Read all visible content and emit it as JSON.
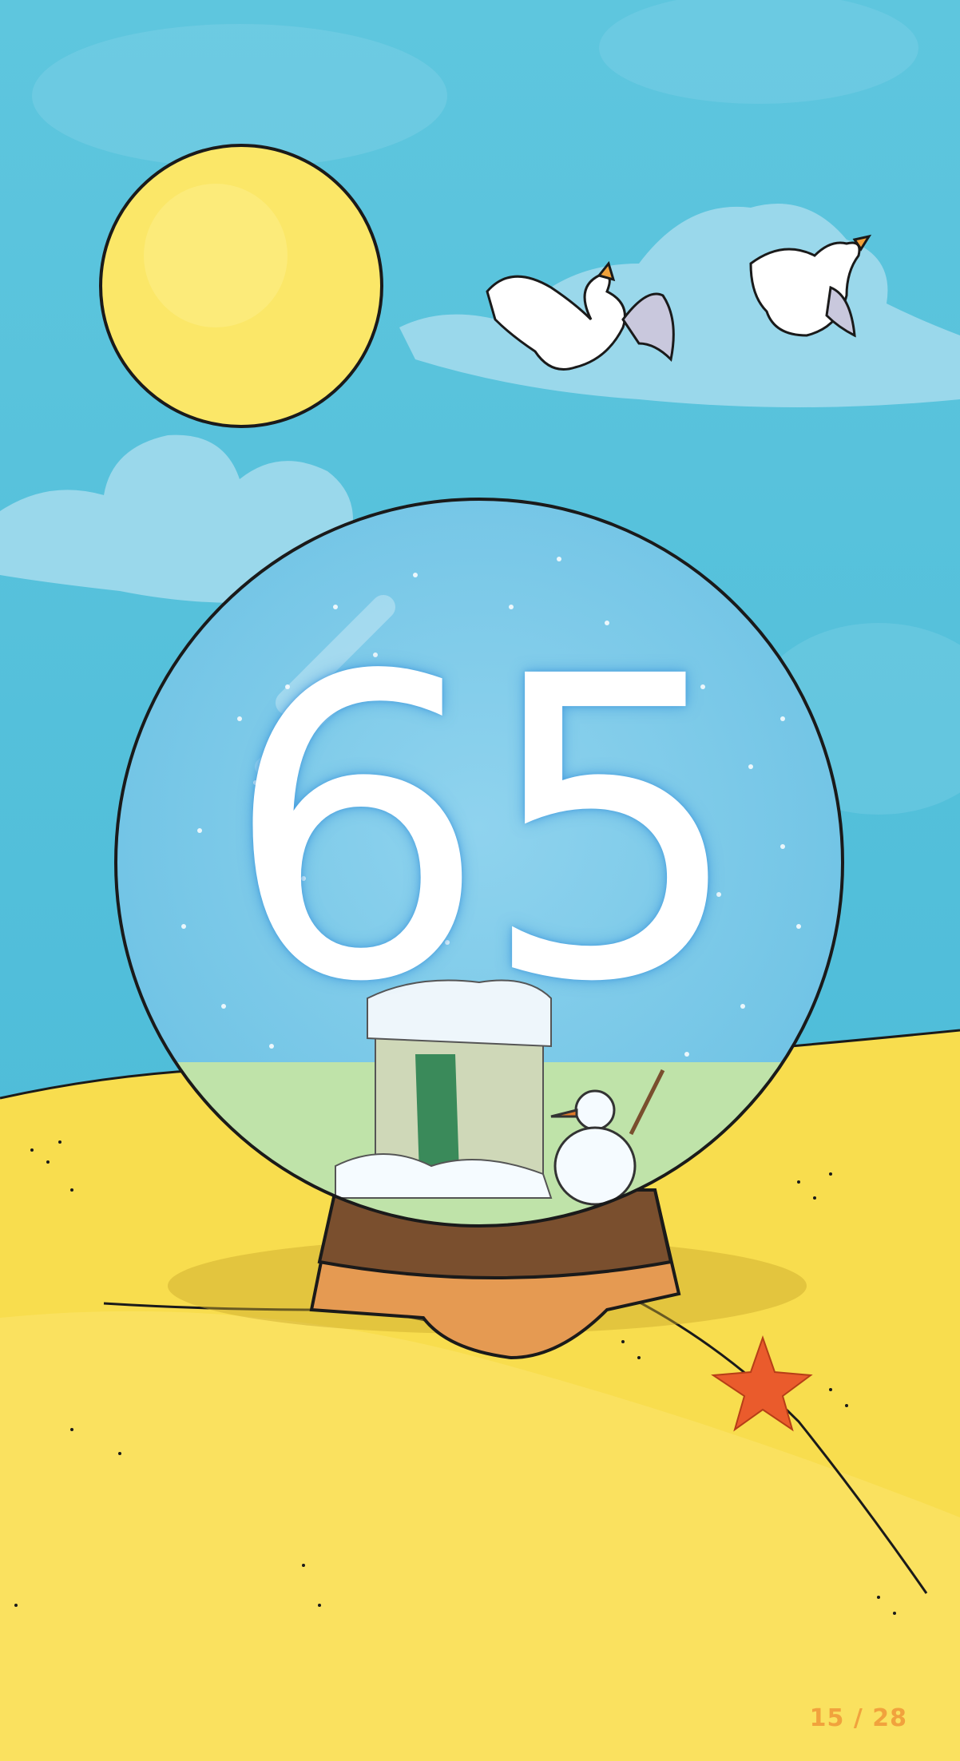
{
  "card": {
    "number": "65",
    "page_counter": "15 / 28"
  },
  "colors": {
    "sky": "#59c3dc",
    "sand": "#f8dd4e",
    "sun": "#fbe768",
    "globe_base_top": "#7a4f2e",
    "globe_base_bottom": "#e59a52",
    "starfish": "#ea5b2c",
    "number": "#ffffff",
    "page_counter": "#f1a23d"
  },
  "icons": [
    "sun-icon",
    "seagull-icon",
    "cloud-icon",
    "snow-globe-icon",
    "snowman-icon",
    "house-icon",
    "starfish-icon"
  ]
}
